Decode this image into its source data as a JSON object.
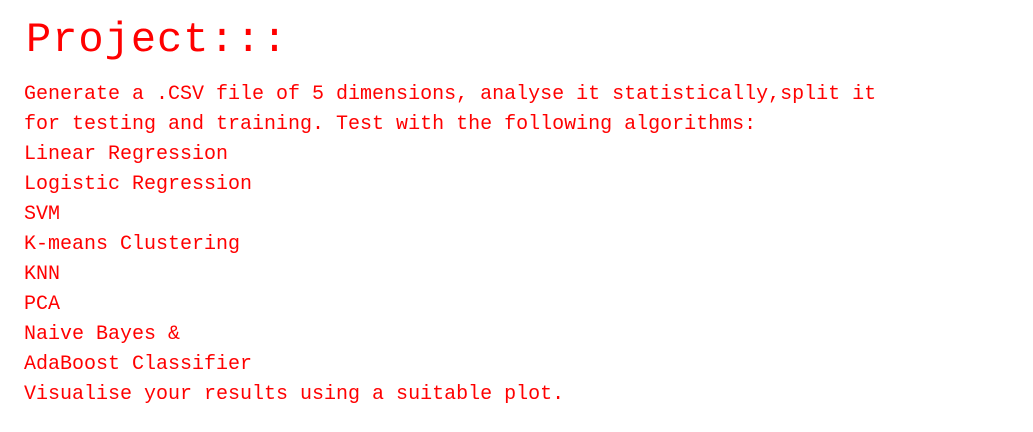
{
  "doc": {
    "title": "Project:::",
    "lines": [
      "Generate a .CSV file of 5 dimensions, analyse it statistically,split it",
      "for testing and training. Test with the following algorithms:",
      "Linear Regression",
      "Logistic Regression",
      "SVM",
      "K-means Clustering",
      "KNN",
      "PCA",
      "Naive Bayes &",
      "AdaBoost Classifier",
      "Visualise your results using a suitable plot."
    ]
  },
  "colors": {
    "text": "#ff0000",
    "background": "#ffffff"
  }
}
